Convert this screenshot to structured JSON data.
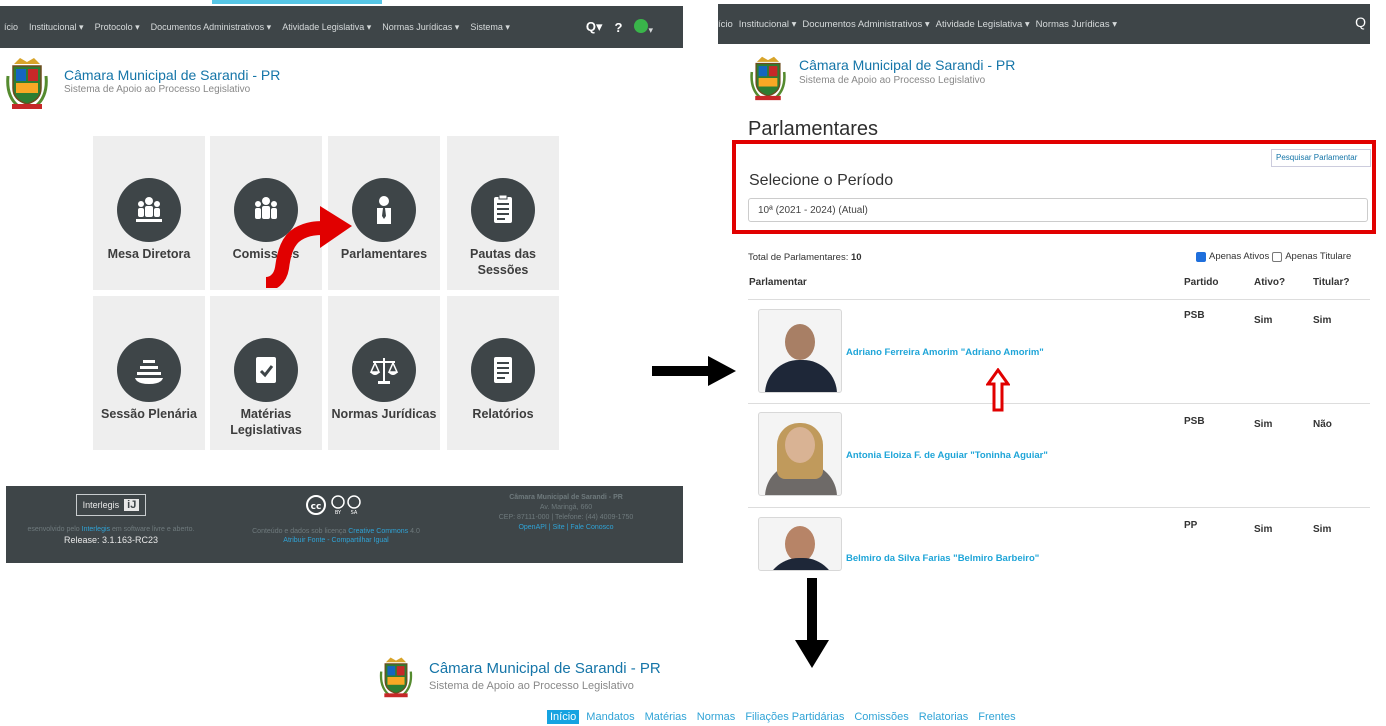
{
  "panel1": {
    "nav": {
      "items": [
        "ício",
        "Institucional ▾",
        "Protocolo ▾",
        "Documentos Administrativos ▾",
        "Atividade Legislativa ▾",
        "Normas Jurídicas ▾",
        "Sistema ▾"
      ],
      "search_label": "Q▾",
      "help_label": "?",
      "user_caret": "▾"
    },
    "header": {
      "title": "Câmara Municipal de Sarandi - PR",
      "subtitle": "Sistema de Apoio ao Processo Legislativo"
    },
    "tiles": [
      {
        "label": "Mesa Diretora",
        "icon": "people-group-icon"
      },
      {
        "label": "Comissões",
        "icon": "people-group-icon"
      },
      {
        "label": "Parlamentares",
        "icon": "person-tie-icon"
      },
      {
        "label": "Pautas das Sessões",
        "icon": "clipboard-icon"
      },
      {
        "label": "Sessão Plenária",
        "icon": "plenary-icon"
      },
      {
        "label": "Matérias Legislativas",
        "icon": "document-check-icon"
      },
      {
        "label": "Normas Jurídicas",
        "icon": "scale-icon"
      },
      {
        "label": "Relatórios",
        "icon": "report-icon"
      }
    ],
    "footer": {
      "interlegis_logo": "Interlegis",
      "developed_text": "esenvolvido pelo ",
      "developed_link": "Interlegis",
      "developed_suffix": " em software livre e aberto.",
      "release": "Release: 3.1.163-RC23",
      "cc_text": "Conteúdo e dados sob licença ",
      "cc_link": "Creative Commons",
      "cc_suffix": " 4.0",
      "cc_attribution": "Atribuir Fonte - Compartilhar Igual",
      "org_name": "Câmara Municipal de Sarandi - PR",
      "org_address": "Av. Maringá, 660",
      "org_contact": "CEP: 87111-000 | Telefone: (44) 4009-1750",
      "org_links": "OpenAPI | Site | Fale Conosco"
    }
  },
  "panel2": {
    "nav": {
      "items": [
        "ício",
        "Institucional ▾",
        "Documentos Administrativos ▾",
        "Atividade Legislativa ▾",
        "Normas Jurídicas ▾"
      ],
      "search_mark": "Q"
    },
    "header": {
      "title": "Câmara Municipal de Sarandi - PR",
      "subtitle": "Sistema de Apoio ao Processo Legislativo"
    },
    "heading": "Parlamentares",
    "search_button": "Pesquisar Parlamentar",
    "period_label": "Selecione o Período",
    "period_value": "10ª (2021 - 2024) (Atual)",
    "total_label": "Total de Parlamentares: ",
    "total_value": "10",
    "filter_active": "Apenas Ativos",
    "filter_holder": "Apenas Titulare",
    "columns": [
      "Parlamentar",
      "Partido",
      "Ativo?",
      "Titular?"
    ],
    "rows": [
      {
        "name": "Adriano Ferreira Amorim \"Adriano Amorim\"",
        "party": "PSB",
        "active": "Sim",
        "holder": "Sim"
      },
      {
        "name": "Antonia Eloiza F. de Aguiar \"Toninha Aguiar\"",
        "party": "PSB",
        "active": "Sim",
        "holder": "Não"
      },
      {
        "name": "Belmiro da Silva Farias \"Belmiro Barbeiro\"",
        "party": "PP",
        "active": "Sim",
        "holder": "Sim"
      }
    ]
  },
  "panel3": {
    "header": {
      "title": "Câmara Municipal de Sarandi - PR",
      "subtitle": "Sistema de Apoio ao Processo Legislativo"
    },
    "nav": [
      "Início",
      "Mandatos",
      "Matérias",
      "Normas",
      "Filiações Partidárias",
      "Comissões",
      "Relatorias",
      "Frentes"
    ]
  },
  "colors": {
    "nav_dark": "#3e4548",
    "brand_blue": "#1575a8",
    "link_blue": "#1fa5d8",
    "highlight_red": "#e10000",
    "active_tab": "#16a3e1"
  }
}
